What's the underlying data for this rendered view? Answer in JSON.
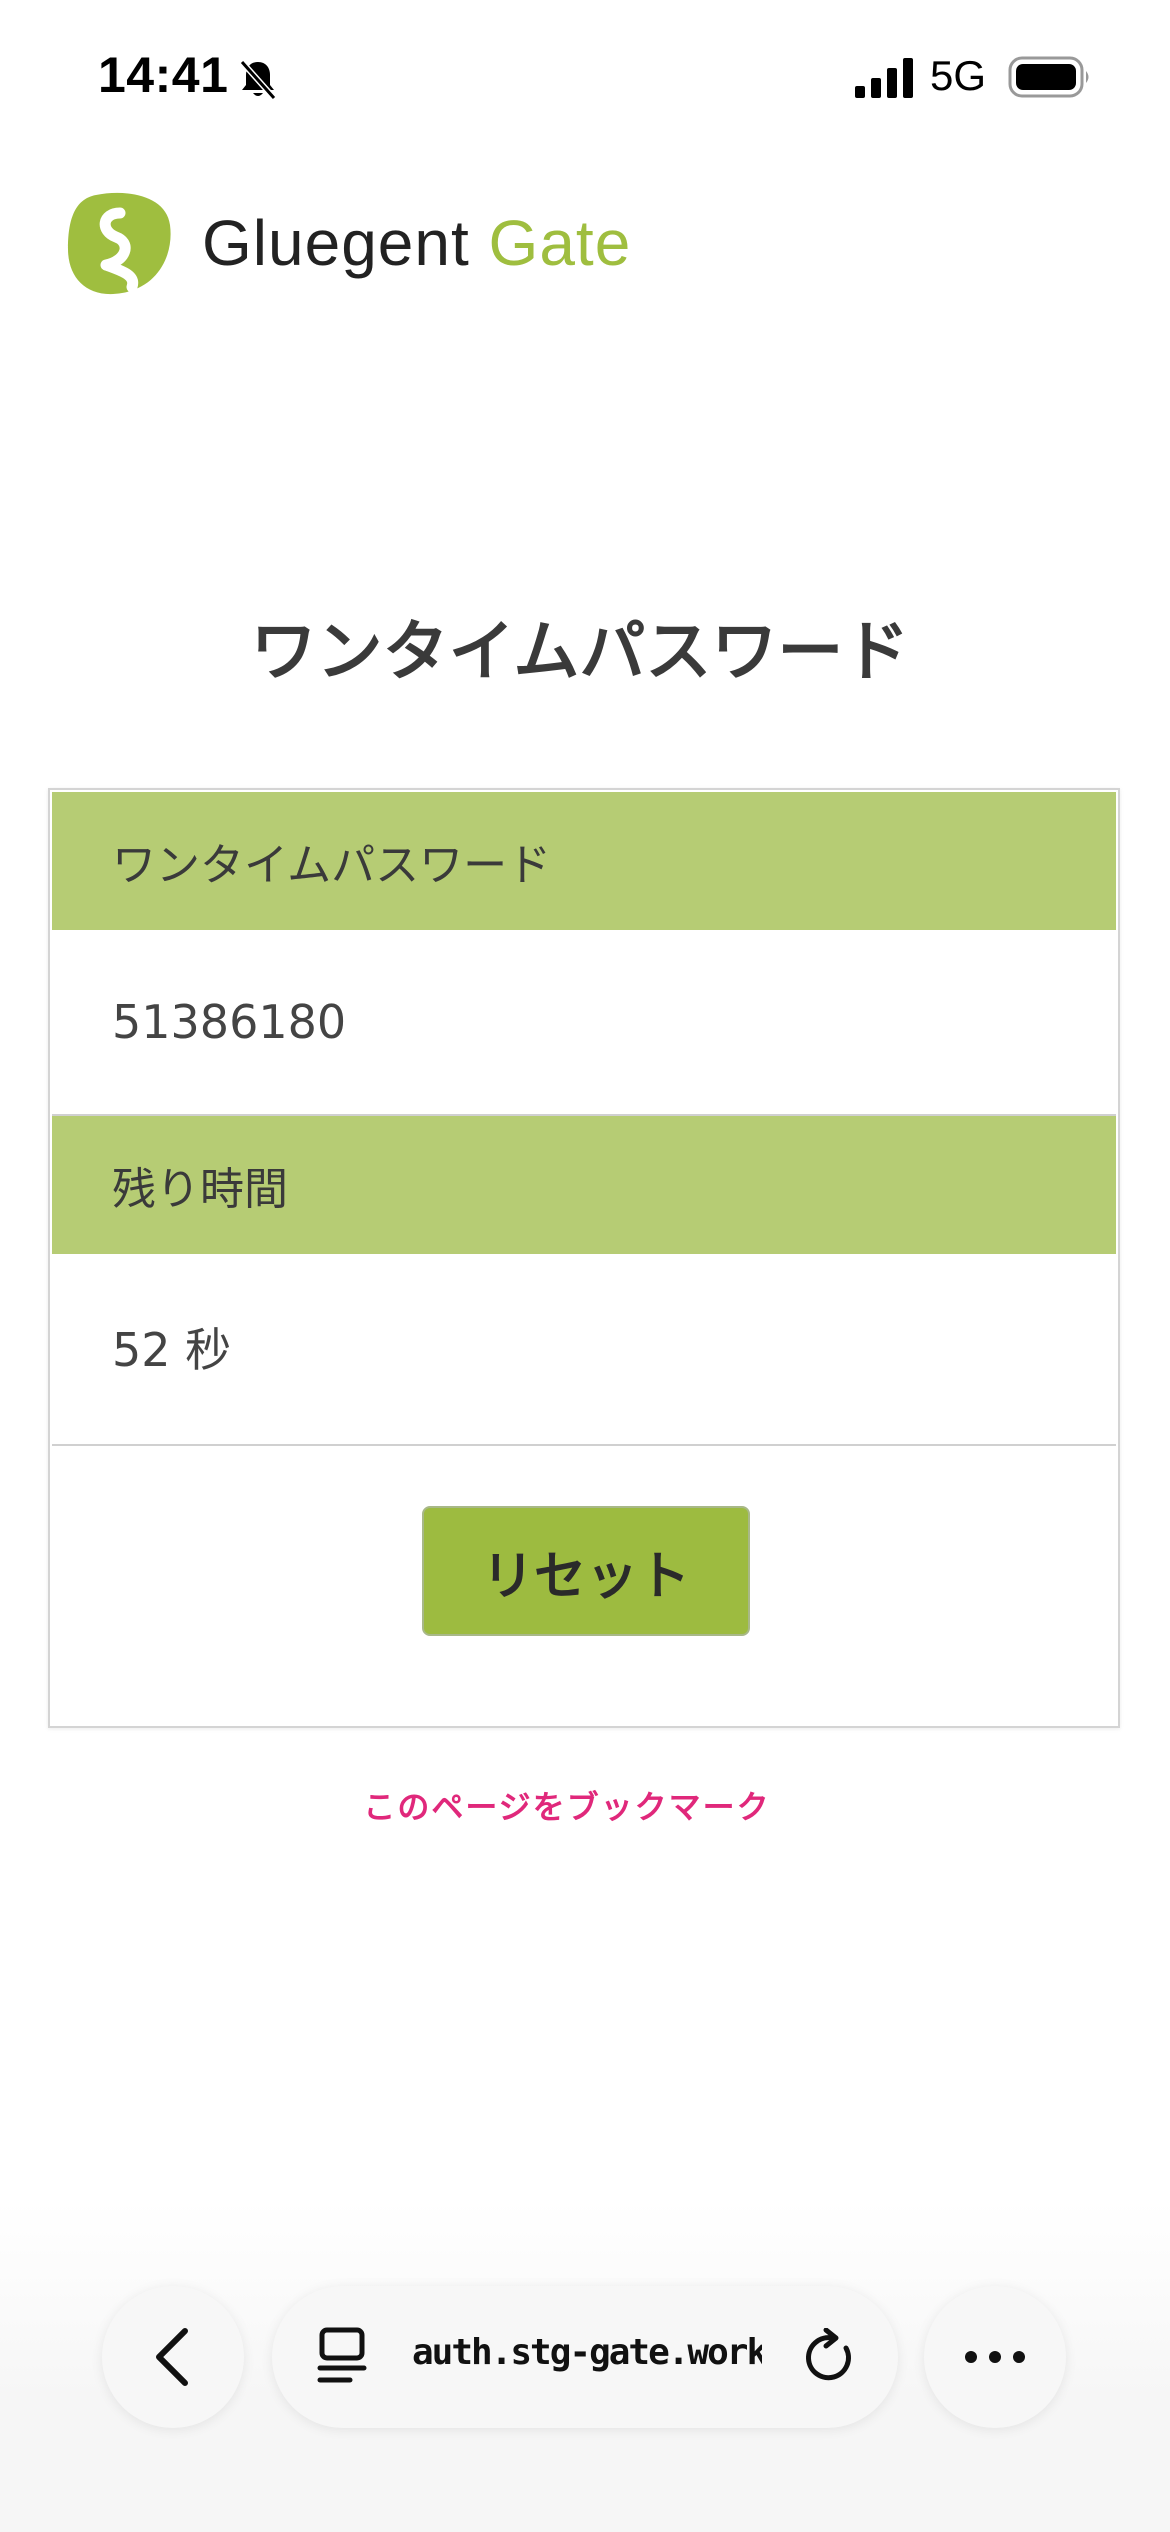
{
  "status_bar": {
    "time": "14:41",
    "network": "5G",
    "icons": [
      "bell-slash-icon",
      "signal-icon",
      "battery-icon"
    ]
  },
  "logo": {
    "word1": "Gluegent",
    "word2": "Gate",
    "colors": {
      "accent": "#9fbe3f",
      "text": "#222222"
    }
  },
  "page": {
    "title": "ワンタイムパスワード"
  },
  "otp_card": {
    "password_label": "ワンタイムパスワード",
    "password_value": "51386180",
    "remaining_label": "残り時間",
    "remaining_value": "52 秒",
    "reset_label": "リセット",
    "colors": {
      "header_bg": "#b6cc74",
      "button_bg": "#9dbb40"
    }
  },
  "bookmark": {
    "label": "このページをブックマーク",
    "color": "#e0287b"
  },
  "browser_bar": {
    "url": "auth.stg-gate.work",
    "icons": [
      "chevron-left-icon",
      "tabs-icon",
      "reload-icon",
      "more-icon"
    ]
  }
}
